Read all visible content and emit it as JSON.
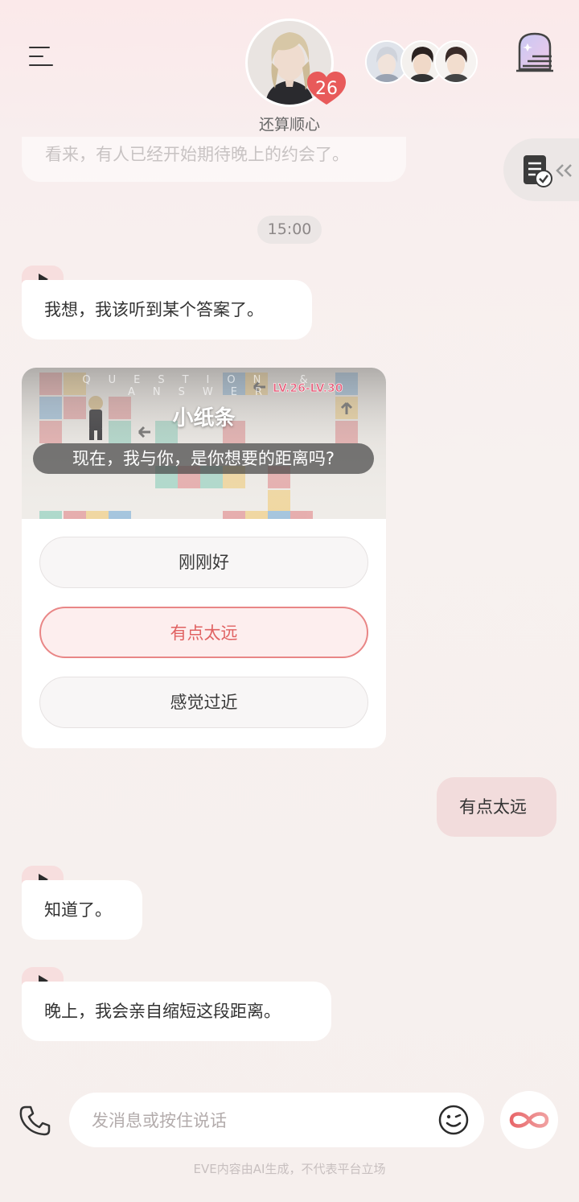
{
  "header": {
    "affection_level": "26",
    "mood_text": "还算顺心",
    "colors": {
      "heart": "#e85a5a",
      "accent": "#e06262"
    }
  },
  "history": {
    "faded_message": "看来，有人已经开始期待晚上的约会了。"
  },
  "timestamp": "15:00",
  "messages": [
    {
      "side": "left",
      "text": "我想，我该听到某个答案了。"
    },
    {
      "side": "right",
      "text": "有点太远"
    },
    {
      "side": "left",
      "text": "知道了。"
    },
    {
      "side": "left",
      "text": "晚上，我会亲自缩短这段距离。"
    }
  ],
  "card": {
    "header_strip": "QUESTION & ANSWER",
    "level_badge": "LV.26-LV.30",
    "title": "小纸条",
    "question": "现在，我与你，是你想要的距离吗?",
    "options": [
      {
        "label": "刚刚好",
        "selected": false
      },
      {
        "label": "有点太远",
        "selected": true
      },
      {
        "label": "感觉过近",
        "selected": false
      }
    ]
  },
  "input": {
    "placeholder": "发消息或按住说话"
  },
  "footer": {
    "disclaimer": "EVE内容由AI生成，不代表平台立场"
  },
  "icons": [
    "menu-icon",
    "avatar",
    "heart-icon",
    "group-avatars",
    "stairs-door-icon",
    "document-check-icon",
    "double-chevron-left-icon",
    "play-icon",
    "phone-icon",
    "emoji-icon",
    "infinity-icon"
  ]
}
